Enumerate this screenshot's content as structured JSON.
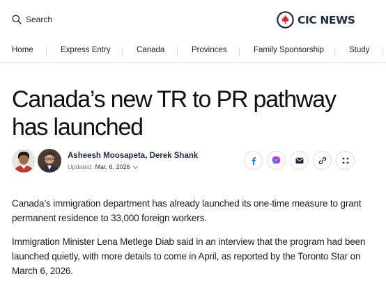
{
  "header": {
    "search_label": "Search",
    "logo_text": "CIC NEWS",
    "brand_color": "#d8212b"
  },
  "nav": {
    "items": [
      {
        "label": "Home"
      },
      {
        "label": "Express Entry"
      },
      {
        "label": "Canada"
      },
      {
        "label": "Provinces"
      },
      {
        "label": "Family Sponsorship"
      },
      {
        "label": "Study"
      }
    ]
  },
  "article": {
    "headline": "Canada’s new TR to PR pathway has launched",
    "authors": "Asheesh Moosapeta, Derek Shank",
    "updated_label": "Updated:",
    "updated_date": "Mar, 6, 2026",
    "paragraphs": [
      "Canada’s immigration department has already launched its one-time measure to grant permanent residence to 33,000 foreign workers.",
      "Immigration Minister Lena Metlege Diab said in an interview that the program had been launched quietly, with more details to come in April, as reported by the Toronto Star on March 6, 2026."
    ]
  },
  "share": {
    "buttons": [
      {
        "icon": "facebook-icon",
        "color": "#1877f2"
      },
      {
        "icon": "messenger-icon",
        "color": "#7b4dff"
      },
      {
        "icon": "email-icon",
        "color": "#1f2a44"
      },
      {
        "icon": "link-icon",
        "color": "#1f2a44"
      },
      {
        "icon": "more-icon",
        "color": "#1f2a44"
      }
    ]
  }
}
